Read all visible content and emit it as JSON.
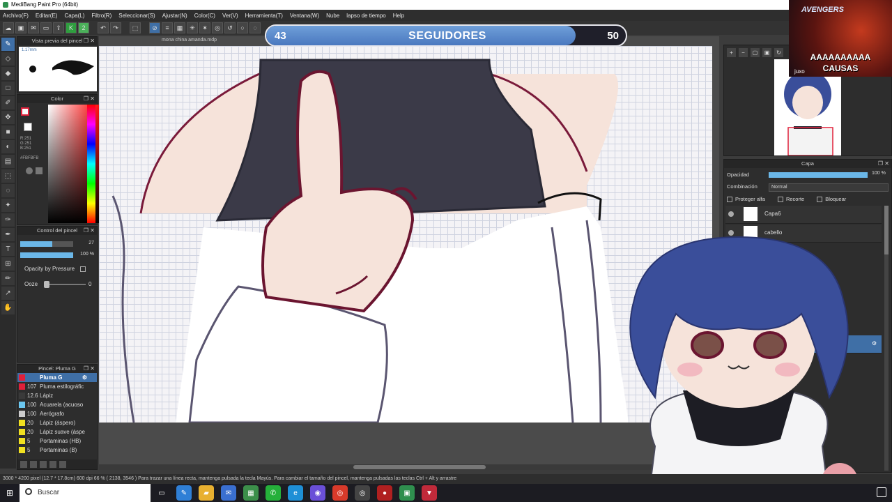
{
  "window": {
    "title": "MediBang Paint Pro (64bit)"
  },
  "menu": [
    "Archivo(F)",
    "Editar(E)",
    "Capa(L)",
    "Filtro(R)",
    "Seleccionar(S)",
    "Ajustar(N)",
    "Color(C)",
    "Ver(V)",
    "Herramienta(T)",
    "Ventana(W)",
    "Nube",
    "lapso de tiempo",
    "Help"
  ],
  "panels": {
    "brush_preview": {
      "title": "Vista previa del pincel",
      "size": "1.17mm"
    },
    "color": {
      "title": "Color",
      "r": "R:251",
      "g": "G:251",
      "b": "B:251",
      "hex": "#FBFBFB",
      "fg": "#fbfbfb"
    },
    "brush_control": {
      "title": "Control del pincel",
      "size_value": "27",
      "size_fraction": 0.6,
      "opacity_value": "100 %",
      "opacity_fraction": 1.0,
      "opacity_by_pressure": "Opacity by Pressure",
      "ooze_label": "Ooze",
      "ooze_value": "0"
    },
    "pen": {
      "title": "Pincel: Pluma G",
      "items": [
        {
          "size": "",
          "name": "Pluma G",
          "color": "#e0203a",
          "selected": true
        },
        {
          "size": "107",
          "name": "Pluma estilográfic",
          "color": "#e0203a",
          "selected": false
        },
        {
          "size": "12.6",
          "name": "Lápiz",
          "color": "#3a3a3a",
          "selected": false
        },
        {
          "size": "100",
          "name": "Acuarela (acuoso",
          "color": "#6bc7f0",
          "selected": false
        },
        {
          "size": "100",
          "name": "Aerógrafo",
          "color": "#cccccc",
          "selected": false
        },
        {
          "size": "20",
          "name": "Lápiz (áspero)",
          "color": "#f0e020",
          "selected": false
        },
        {
          "size": "20",
          "name": "Lápiz suave (áspe",
          "color": "#f0e020",
          "selected": false
        },
        {
          "size": "5",
          "name": "Portaminas (HB)",
          "color": "#f0e020",
          "selected": false
        },
        {
          "size": "5",
          "name": "Portaminas (B)",
          "color": "#f0e020",
          "selected": false
        }
      ]
    },
    "layer": {
      "title": "Capa",
      "opacity_label": "Opacidad",
      "opacity_value": "100 %",
      "opacity_fraction": 1.0,
      "blend_label": "Combinación",
      "blend_value": "Normal",
      "protect_alpha": "Proteger alfa",
      "clipping": "Recorte",
      "lock": "Bloquear",
      "layers": [
        "Capa6",
        "cabello"
      ]
    }
  },
  "document": {
    "tab": "mona china amanda.mdp"
  },
  "overlay": {
    "followers_current": "43",
    "followers_label": "SEGUIDORES",
    "followers_goal": "50",
    "followers_fraction": 0.86,
    "cam_logo": "AVENGERS",
    "cam_caption_1": "AAAAAAAAAA",
    "cam_caption_2": "CAUSAS",
    "cam_handle": "juxo"
  },
  "status": {
    "text": "3000 * 4200 pixel   (12.7 * 17.8cm)   600 dpi   66 %   ( 2138, 3546 )   Para trazar una línea recta, mantenga pulsada la tecla Mayús. Para cambiar el tamaño del pincel, mantenga pulsadas las teclas Ctrl + Alt y arrastre"
  },
  "taskbar": {
    "search_placeholder": "Buscar"
  },
  "colors": {
    "accent": "#3f6fa6",
    "slider": "#6bb7e8",
    "ink": "#6b1530",
    "skin": "#f6e3da",
    "shirt": "#3b3a48"
  }
}
